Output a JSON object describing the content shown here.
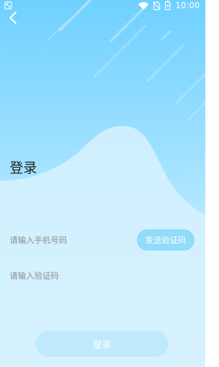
{
  "status_bar": {
    "time": "10:00",
    "icons": [
      "notification-icon",
      "wifi-icon",
      "no-sim-icon",
      "battery-charging-icon"
    ]
  },
  "nav": {
    "back_icon": "chevron-left-icon"
  },
  "title": "登录",
  "phone_field": {
    "value": "",
    "placeholder": "请输入手机号码"
  },
  "send_code_button": {
    "label": "发送验证码"
  },
  "code_field": {
    "value": "",
    "placeholder": "请输入验证码"
  },
  "login_button": {
    "label": "登录"
  },
  "colors": {
    "gradient_top": "#6fd0ff",
    "gradient_bottom": "#ecf9ff",
    "send_code_button": "#8fdcfb",
    "login_button_disabled": "#bfeafc",
    "title_text": "#1f1f1f",
    "placeholder_text": "#8e8e8e"
  }
}
